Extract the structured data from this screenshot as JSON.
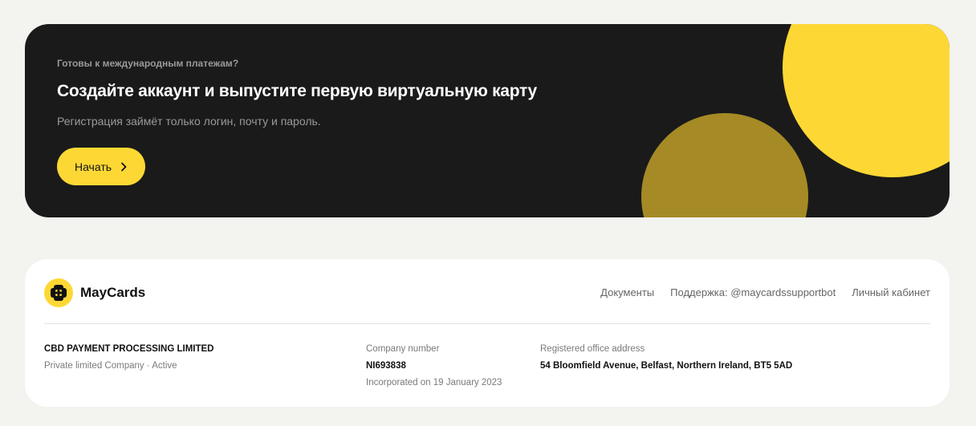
{
  "promo": {
    "kicker": "Готовы к международным платежам?",
    "title": "Создайте аккаунт и выпустите первую виртуальную карту",
    "subtitle": "Регистрация займёт только логин, почту и пароль.",
    "button_label": "Начать",
    "button_icon": "chevron-right-icon"
  },
  "footer": {
    "brand": "MayCards",
    "logo_icon": "maycards-logo-icon",
    "nav": {
      "documents": "Документы",
      "support": "Поддержка: @maycardssupportbot",
      "account": "Личный кабинет"
    },
    "company": {
      "name": "CBD PAYMENT PROCESSING LIMITED",
      "status": "Private limited Company · Active"
    },
    "registration": {
      "label": "Company number",
      "number": "NI693838",
      "incorporated": "Incorporated on 19 January 2023"
    },
    "office": {
      "label": "Registered office address",
      "address": "54 Bloomfield Avenue, Belfast, Northern Ireland, BT5 5AD"
    }
  },
  "colors": {
    "accent": "#fdd835",
    "accent_dark": "#a58a26",
    "banner_bg": "#1a1a1a",
    "page_bg": "#f3f3ef"
  }
}
